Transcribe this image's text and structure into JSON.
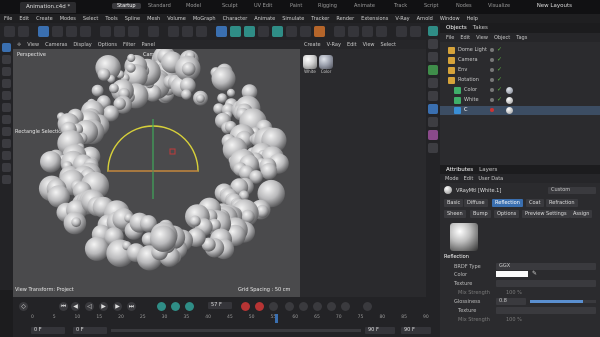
{
  "titlebar": {
    "document": "Animation.c4d *",
    "workspaces": [
      "Startup",
      "Standard",
      "Model",
      "Sculpt",
      "UV Edit",
      "Paint",
      "Rigging",
      "Animate",
      "Track",
      "Script",
      "Nodes",
      "Visualize"
    ],
    "active_workspace": "Startup",
    "layouts_label": "New Layouts"
  },
  "menubar": [
    "File",
    "Edit",
    "Create",
    "Modes",
    "Select",
    "Tools",
    "Spline",
    "Mesh",
    "Volume",
    "MoGraph",
    "Character",
    "Animate",
    "Simulate",
    "Tracker",
    "Render",
    "Extensions",
    "V-Ray",
    "Arnold",
    "Window",
    "Help"
  ],
  "viewport": {
    "menu": [
      "View",
      "Cameras",
      "Display",
      "Options",
      "Filter",
      "Panel"
    ],
    "camera_label": "Camera",
    "perspective_label": "Perspective",
    "tool_label": "Rectangle Selection",
    "transform_label": "View Transform: Project",
    "grid_label": "Grid Spacing : 50 cm"
  },
  "material_manager": {
    "menu": [
      "Create",
      "V-Ray",
      "Edit",
      "View",
      "Select"
    ],
    "materials": [
      {
        "name": "White",
        "color": "#e8e8e8"
      },
      {
        "name": "Color",
        "color": "#9ea3b0"
      }
    ]
  },
  "object_manager": {
    "tabs": [
      "Objects",
      "Takes"
    ],
    "menu": [
      "File",
      "Edit",
      "View",
      "Object",
      "Tags"
    ],
    "objects": [
      {
        "name": "Dome Light",
        "icon_color": "#d6a33a",
        "indent": 0
      },
      {
        "name": "Camera",
        "icon_color": "#d6a33a",
        "indent": 0
      },
      {
        "name": "Env",
        "icon_color": "#d6a33a",
        "indent": 0
      },
      {
        "name": "Rotation",
        "icon_color": "#d6a33a",
        "indent": 0
      },
      {
        "name": "Color",
        "icon_color": "#3fae6a",
        "indent": 1
      },
      {
        "name": "White",
        "icon_color": "#3fae6a",
        "indent": 1
      },
      {
        "name": "C",
        "icon_color": "#3a8fd6",
        "indent": 1
      }
    ]
  },
  "attributes": {
    "tabs": [
      "Attributes",
      "Layers"
    ],
    "menu": [
      "Mode",
      "Edit",
      "User Data"
    ],
    "material_name": "VRayMtl [White.1]",
    "preset_value": "Custom",
    "panel_tabs_row1": [
      "Basic",
      "Diffuse",
      "Reflection",
      "Coat",
      "Refraction"
    ],
    "panel_tabs_row2": [
      "Sheen",
      "Bump",
      "Options",
      "Preview Settings",
      "Assign"
    ],
    "active_tab": "Reflection",
    "section": "Reflection",
    "brdf_label": "BRDF Type",
    "brdf_value": "GGX",
    "color_label": "Color",
    "texture_label": "Texture",
    "mix_strength_label": "Mix Strength",
    "mix_strength_value": "100 %",
    "glossiness_label": "Glossiness",
    "glossiness_value": "0.8",
    "texture2_label": "Texture",
    "mix_strength2_label": "Mix Strength",
    "mix_strength2_value": "100 %"
  },
  "timeline": {
    "current_frame": "57 F",
    "start": "0 F",
    "end": "90 F",
    "start2": "0 F",
    "end2": "90 F",
    "ticks": [
      "0",
      "5",
      "10",
      "15",
      "20",
      "25",
      "30",
      "35",
      "40",
      "45",
      "50",
      "55",
      "60",
      "65",
      "70",
      "75",
      "80",
      "85",
      "90"
    ]
  }
}
